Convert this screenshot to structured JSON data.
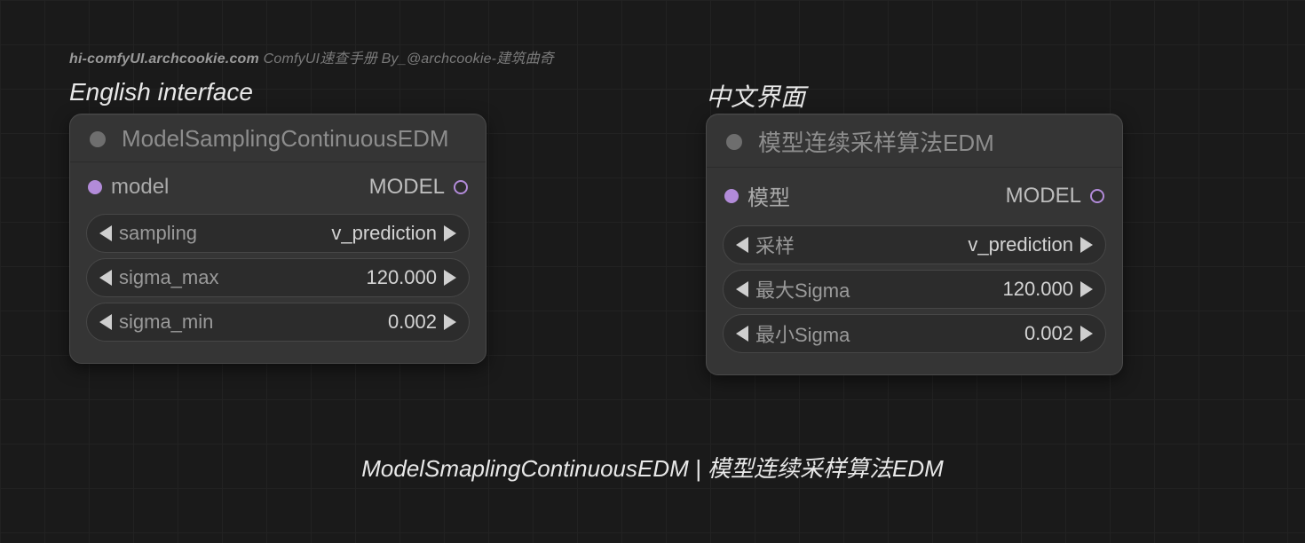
{
  "watermark": {
    "site": "hi-comfyUI.archcookie.com",
    "tagline": "ComfyUI速查手册 By_@archcookie-建筑曲奇"
  },
  "labels": {
    "english_interface": "English interface",
    "chinese_interface": "中文界面"
  },
  "nodes": {
    "en": {
      "title": "ModelSamplingContinuousEDM",
      "input_label": "model",
      "output_label": "MODEL",
      "widgets": [
        {
          "name": "sampling",
          "value": "v_prediction"
        },
        {
          "name": "sigma_max",
          "value": "120.000"
        },
        {
          "name": "sigma_min",
          "value": "0.002"
        }
      ]
    },
    "cn": {
      "title": "模型连续采样算法EDM",
      "input_label": "模型",
      "output_label": "MODEL",
      "widgets": [
        {
          "name": "采样",
          "value": "v_prediction"
        },
        {
          "name": "最大Sigma",
          "value": "120.000"
        },
        {
          "name": "最小Sigma",
          "value": "0.002"
        }
      ]
    }
  },
  "caption": "ModelSmaplingContinuousEDM | 模型连续采样算法EDM",
  "colors": {
    "port": "#b28bd9",
    "node_bg": "#353535",
    "widget_bg": "#2c2c2c"
  }
}
